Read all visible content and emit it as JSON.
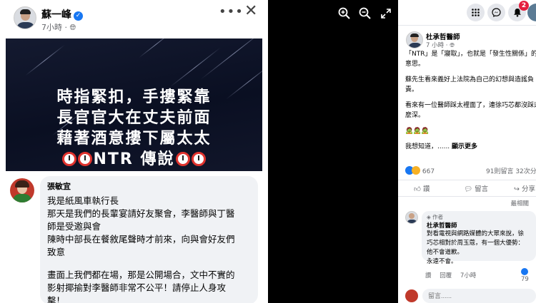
{
  "photo_post": {
    "author_name": "蘇一峰",
    "time": "7小時 · ",
    "globe_icon": "globe-icon",
    "banner": {
      "line1": "時指緊扣，手摟緊靠",
      "line2": "長官官大在丈夫前面",
      "line3": "藉著酒意摟下屬太太",
      "line4": "NTR 傳說"
    },
    "comment": {
      "name": "張敏宜",
      "lines": [
        "我是紙風車執行長",
        "那天是我們的長輩宴請好友聚會，李醫師與丁醫",
        "師是受邀與會",
        "陳時中部長在餐敘尾聲時才前來，向與會好友們",
        "致意",
        "畫面上我們都在場，那是公開場合，文中不實的",
        "影射揶揄對李醫師非常不公平！請停止人身攻",
        "擊！"
      ]
    }
  },
  "toolbar": {
    "notification_count": "2"
  },
  "side_post": {
    "author": "杜承哲醫師",
    "time": "7 小時 · ",
    "lines": [
      "「NTR」是「寢取」，也就是「發生性關係」的",
      "意思。",
      "蘇先生看來義好上法院為自己的幻想與造謠負",
      "責。",
      "看來有一位醫師踩太裡面了，連徐巧芯都沒踩這",
      "麼深。",
      "🧟🧟🧟",
      "我想知道，...... "
    ],
    "see_more": "顯示更多",
    "reaction_count": "667",
    "comment_share": "91則留言  32次分",
    "actions": [
      "讚",
      "留言",
      "分享"
    ],
    "sort": "最相關",
    "reply": {
      "tag": "作者",
      "name": "杜承哲醫師",
      "lines": [
        "對看電視與網路媒體的大眾來說，徐",
        "巧芯相對於周玉蔻，有一個大優勢：",
        "他不會道歉。",
        "永遠不會。"
      ],
      "actions": [
        "讚",
        "回覆",
        "7小時"
      ],
      "likes": "79"
    },
    "composer_placeholder": "留言......"
  },
  "colors": {
    "accent": "#1877f2",
    "notification": "#e41e3f",
    "banner_bg": "#0a0f22",
    "clock_red": "#e0332e"
  }
}
